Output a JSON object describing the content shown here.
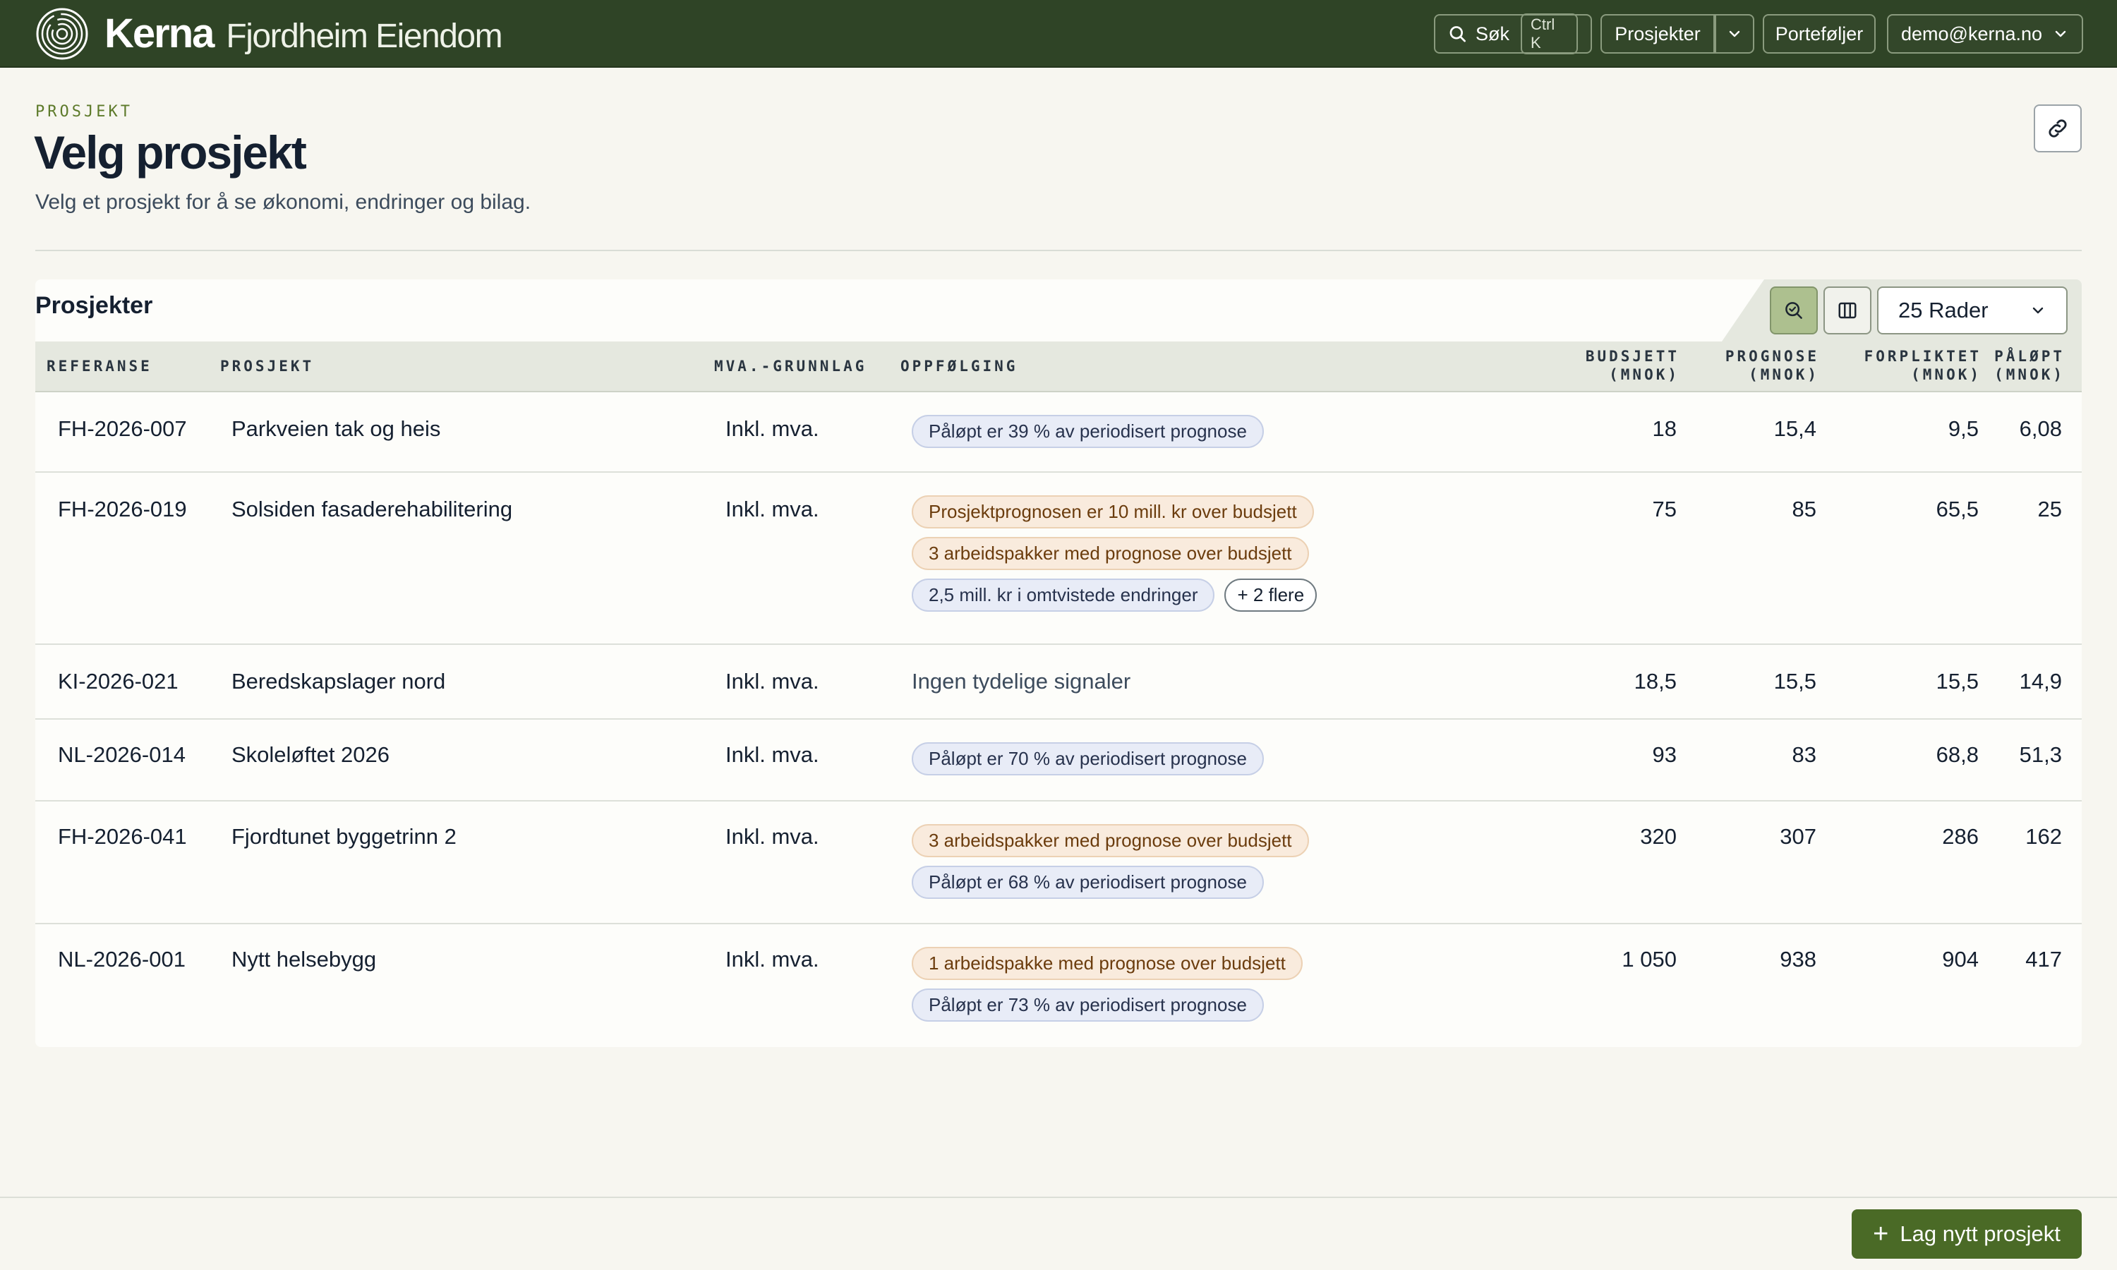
{
  "brand": {
    "name": "Kerna",
    "org": "Fjordheim Eiendom"
  },
  "topnav": {
    "search_label": "Søk",
    "search_shortcut": "Ctrl K",
    "projects_label": "Prosjekter",
    "portfolios_label": "Porteføljer",
    "user_email": "demo@kerna.no"
  },
  "header": {
    "eyebrow": "PROSJEKT",
    "title": "Velg prosjekt",
    "subtitle": "Velg et prosjekt for å se økonomi, endringer og bilag."
  },
  "table": {
    "title": "Prosjekter",
    "rows_per_page": "25 Rader",
    "columns": {
      "ref": "REFERANSE",
      "project": "PROSJEKT",
      "vat": "MVA.-GRUNNLAG",
      "followup": "OPPFØLGING",
      "budget_1": "BUDSJETT",
      "budget_2": "(MNOK)",
      "forecast_1": "PROGNOSE",
      "forecast_2": "(MNOK)",
      "committed_1": "FORPLIKTET",
      "committed_2": "(MNOK)",
      "accrued_1": "PÅLØPT",
      "accrued_2": "(MNOK)"
    },
    "rows": [
      {
        "ref": "FH-2026-007",
        "name": "Parkveien tak og heis",
        "vat": "Inkl. mva.",
        "signals": [
          {
            "text": "Påløpt er 39 % av periodisert prognose",
            "tone": "blue"
          }
        ],
        "budget": "18",
        "forecast": "15,4",
        "committed": "9,5",
        "accrued": "6,08"
      },
      {
        "ref": "FH-2026-019",
        "name": "Solsiden fasaderehabilitering",
        "vat": "Inkl. mva.",
        "signals": [
          {
            "text": "Prosjektprognosen er 10 mill. kr over budsjett",
            "tone": "amber"
          },
          {
            "text": "3 arbeidspakker med prognose over budsjett",
            "tone": "amber"
          },
          {
            "text": "2,5 mill. kr i omtvistede endringer",
            "tone": "blue"
          }
        ],
        "more": "+ 2 flere",
        "budget": "75",
        "forecast": "85",
        "committed": "65,5",
        "accrued": "25"
      },
      {
        "ref": "KI-2026-021",
        "name": "Beredskapslager nord",
        "vat": "Inkl. mva.",
        "no_signal": "Ingen tydelige signaler",
        "budget": "18,5",
        "forecast": "15,5",
        "committed": "15,5",
        "accrued": "14,9"
      },
      {
        "ref": "NL-2026-014",
        "name": "Skoleløftet 2026",
        "vat": "Inkl. mva.",
        "signals": [
          {
            "text": "Påløpt er 70 % av periodisert prognose",
            "tone": "blue"
          }
        ],
        "budget": "93",
        "forecast": "83",
        "committed": "68,8",
        "accrued": "51,3"
      },
      {
        "ref": "FH-2026-041",
        "name": "Fjordtunet byggetrinn 2",
        "vat": "Inkl. mva.",
        "signals": [
          {
            "text": "3 arbeidspakker med prognose over budsjett",
            "tone": "amber"
          },
          {
            "text": "Påløpt er 68 % av periodisert prognose",
            "tone": "blue"
          }
        ],
        "budget": "320",
        "forecast": "307",
        "committed": "286",
        "accrued": "162"
      },
      {
        "ref": "NL-2026-001",
        "name": "Nytt helsebygg",
        "vat": "Inkl. mva.",
        "signals": [
          {
            "text": "1 arbeidspakke med prognose over budsjett",
            "tone": "amber"
          },
          {
            "text": "Påløpt er 73 % av periodisert prognose",
            "tone": "blue"
          }
        ],
        "budget": "1 050",
        "forecast": "938",
        "committed": "904",
        "accrued": "417"
      }
    ]
  },
  "footer": {
    "create_label": "Lag nytt prosjekt"
  },
  "colors": {
    "topbar": "#2f4426",
    "accent": "#4a6a26",
    "amber_badge": "#f9ebdd",
    "blue_badge": "#e8ecf7"
  }
}
